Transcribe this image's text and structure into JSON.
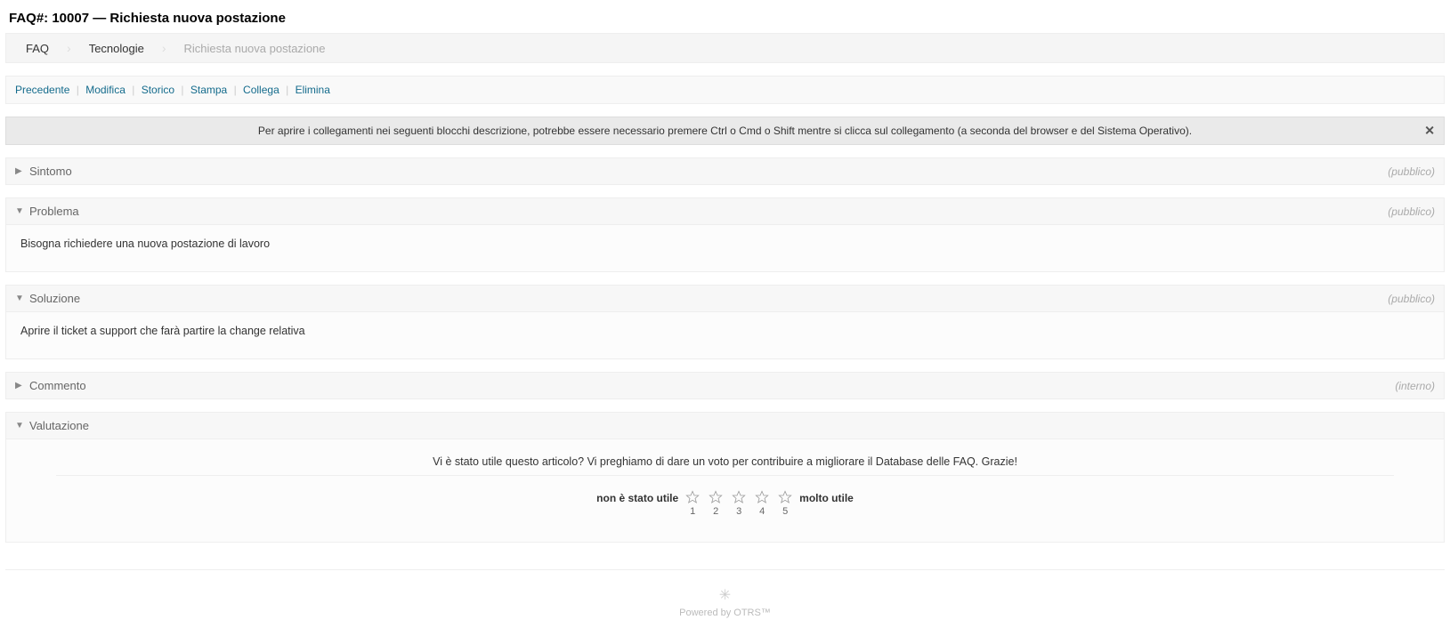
{
  "title": "FAQ#: 10007 — Richiesta nuova postazione",
  "breadcrumb": {
    "items": [
      {
        "label": "FAQ"
      },
      {
        "label": "Tecnologie"
      },
      {
        "label": "Richiesta nuova postazione"
      }
    ]
  },
  "actions": {
    "precedente": "Precedente",
    "modifica": "Modifica",
    "storico": "Storico",
    "stampa": "Stampa",
    "collega": "Collega",
    "elimina": "Elimina"
  },
  "notice": "Per aprire i collegamenti nei seguenti blocchi descrizione, potrebbe essere necessario premere Ctrl o Cmd o Shift mentre si clicca sul collegamento (a seconda del browser e del Sistema Operativo).",
  "panels": {
    "sintomo": {
      "title": "Sintomo",
      "visibility": "(pubblico)"
    },
    "problema": {
      "title": "Problema",
      "visibility": "(pubblico)",
      "body": "Bisogna richiedere una nuova postazione di lavoro"
    },
    "soluzione": {
      "title": "Soluzione",
      "visibility": "(pubblico)",
      "body": "Aprire il ticket a support che farà partire la change relativa"
    },
    "commento": {
      "title": "Commento",
      "visibility": "(interno)"
    },
    "valutazione": {
      "title": "Valutazione",
      "prompt": "Vi è stato utile questo articolo? Vi preghiamo di dare un voto per contribuire a migliorare il Database delle FAQ. Grazie!",
      "lowLabel": "non è stato utile",
      "highLabel": "molto utile",
      "stars": [
        "1",
        "2",
        "3",
        "4",
        "5"
      ]
    }
  },
  "footer": "Powered by OTRS™"
}
